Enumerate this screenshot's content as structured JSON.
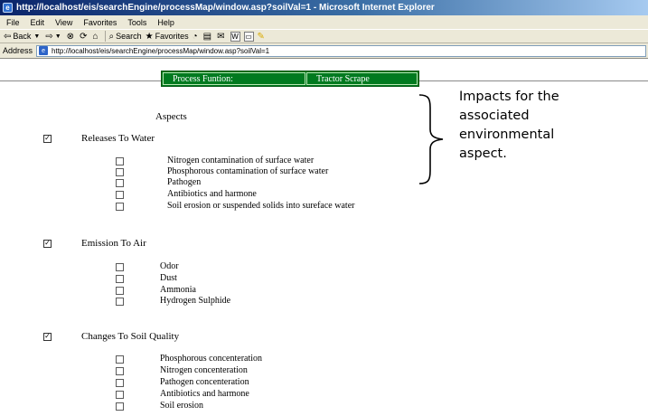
{
  "window": {
    "title": "http://localhost/eis/searchEngine/processMap/window.asp?soilVal=1 - Microsoft Internet Explorer"
  },
  "menu": [
    "File",
    "Edit",
    "View",
    "Favorites",
    "Tools",
    "Help"
  ],
  "toolbar": {
    "back": "Back",
    "search": "Search",
    "favorites": "Favorites"
  },
  "address": {
    "label": "Address",
    "url": "http://localhost/eis/searchEngine/processMap/window.asp?soilVal=1"
  },
  "process": {
    "label": "Process Funtion:",
    "value": "Tractor Scrape"
  },
  "aspects_title": "Aspects",
  "aspects": [
    {
      "label": "Releases To Water",
      "checked": true,
      "impacts": [
        "Nitrogen contamination of surface water",
        "Phosphorous contamination of surface water",
        "Pathogen",
        "Antibiotics and harmone",
        "Soil erosion or suspended solids into sureface water"
      ]
    },
    {
      "label": "Emission To Air",
      "checked": true,
      "impacts": [
        "Odor",
        "Dust",
        "Ammonia",
        "Hydrogen Sulphide"
      ]
    },
    {
      "label": "Changes To Soil Quality",
      "checked": true,
      "impacts": [
        "Phosphorous concenteration",
        "Nitrogen concenteration",
        "Pathogen concenteration",
        "Antibiotics and harmone",
        "Soil erosion"
      ]
    }
  ],
  "annotation": {
    "lines": [
      "Impacts for the",
      "associated",
      "environmental",
      "aspect."
    ]
  }
}
